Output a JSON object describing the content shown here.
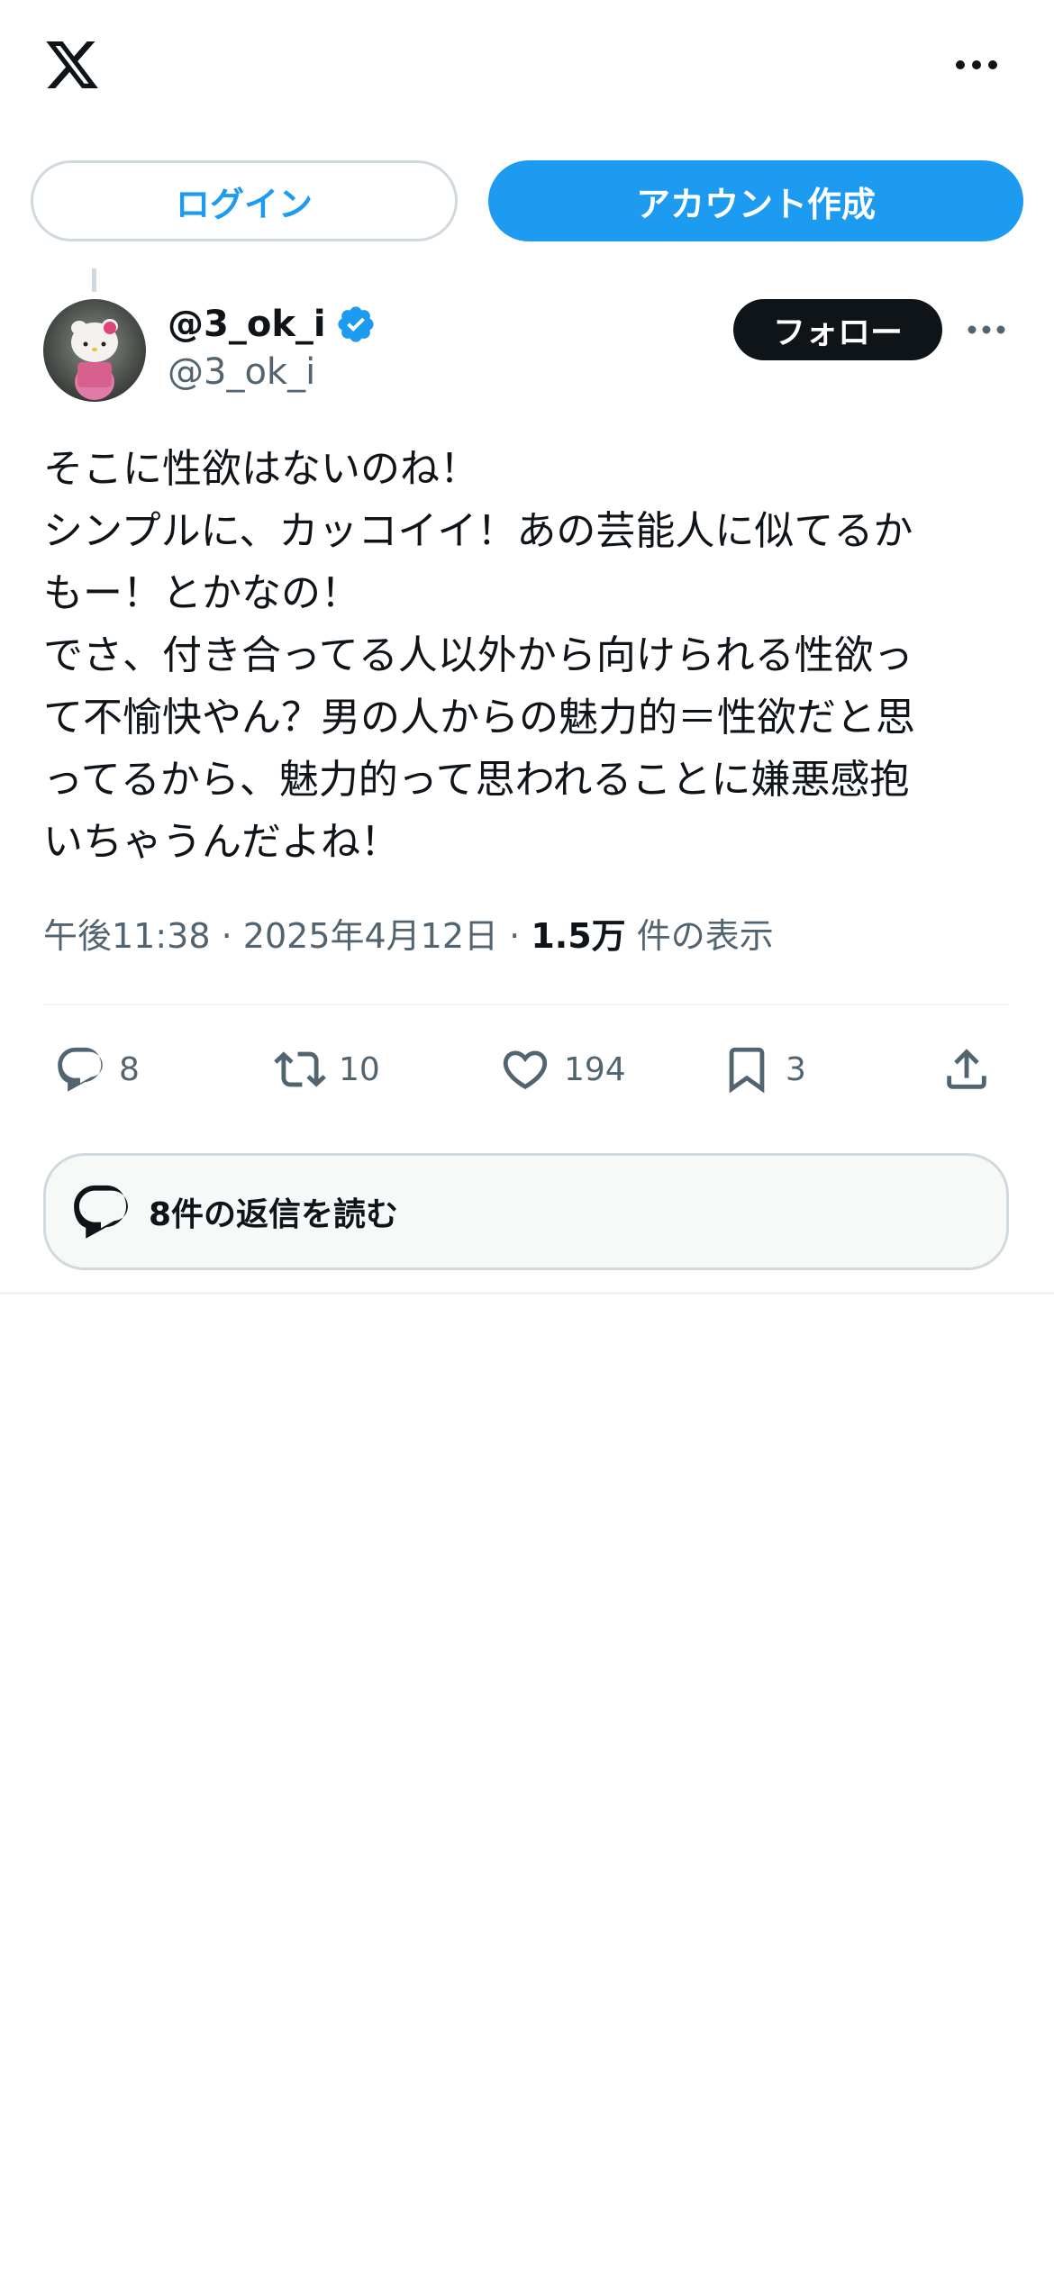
{
  "header": {
    "logo_icon": "x-logo-icon",
    "more_icon": "more-horizontal-icon"
  },
  "auth": {
    "login_label": "ログイン",
    "signup_label": "アカウント作成"
  },
  "post": {
    "display_name": "@3_ok_i",
    "handle": "@3_ok_i",
    "verified": true,
    "follow_label": "フォロー",
    "text": "そこに性欲はないのね！\nシンプルに、カッコイイ！あの芸能人に似てるか\nもー！とかなの！\nでさ、付き合ってる人以外から向けられる性欲っ\nて不愉快やん？男の人からの魅力的＝性欲だと思\nってるから、魅力的って思われることに嫌悪感抱\nいちゃうんだよね！",
    "time": "午後11:38",
    "date": "2025年4月12日",
    "views_count": "1.5万",
    "views_label": "件の表示",
    "separator": "·"
  },
  "actions": {
    "reply_count": "8",
    "repost_count": "10",
    "like_count": "194",
    "bookmark_count": "3"
  },
  "replies_button": {
    "label": "8件の返信を読む"
  },
  "colors": {
    "accent": "#1d9bf0",
    "text": "#0f1419",
    "secondary": "#536471",
    "border": "#cfd9de"
  }
}
